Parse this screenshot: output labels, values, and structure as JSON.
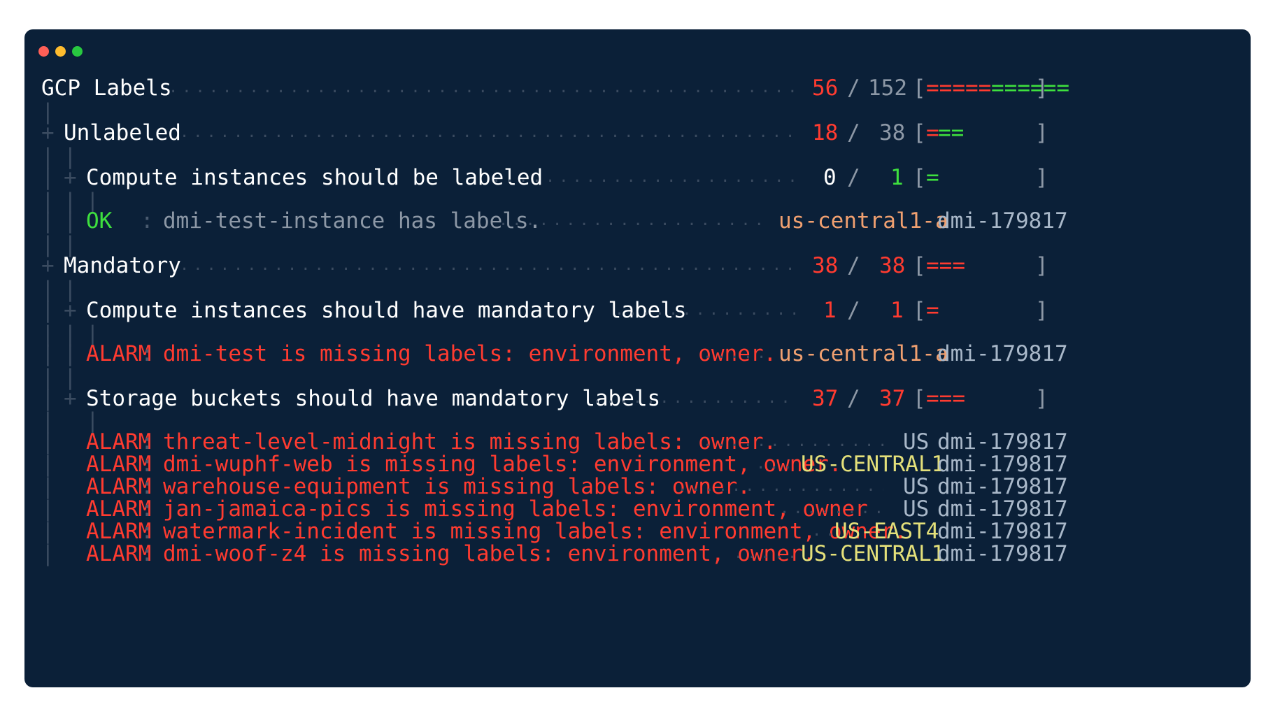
{
  "window": {
    "controls": [
      "close",
      "minimize",
      "maximize"
    ]
  },
  "rows": {
    "root": {
      "title": "GCP Labels",
      "alarm": "56",
      "sep": "/",
      "total": "152",
      "bar_open": "[",
      "bar_red": "=====",
      "bar_green": "======",
      "bar_close": "]"
    },
    "unlabeled": {
      "tree": "+",
      "title": "Unlabeled",
      "alarm": "18",
      "sep": "/",
      "total": "38",
      "bar_open": "[",
      "bar_red": "=",
      "bar_green": "==",
      "bar_close": "]"
    },
    "unlabeled_ctrl": {
      "tree": "+",
      "title": "Compute instances should be labeled",
      "alarm": "0",
      "sep": "/",
      "total": "1",
      "bar_open": "[",
      "bar_green": "=",
      "bar_close": "]"
    },
    "ok_result": {
      "status": "OK",
      "colon": ":",
      "message": "dmi-test-instance has labels.",
      "region": "us-central1-a",
      "project": "dmi-179817"
    },
    "mandatory": {
      "tree": "+",
      "title": "Mandatory",
      "alarm": "38",
      "sep": "/",
      "total": "38",
      "bar_open": "[",
      "bar_red": "===",
      "bar_close": "]"
    },
    "mandatory_compute": {
      "tree": "+",
      "title": "Compute instances should have mandatory labels",
      "alarm": "1",
      "sep": "/",
      "total": "1",
      "bar_open": "[",
      "bar_red": "=",
      "bar_close": "]"
    },
    "compute_alarm": {
      "status": "ALARM",
      "colon": ":",
      "message": "dmi-test is missing labels: environment, owner.",
      "region": "us-central1-a",
      "project": "dmi-179817"
    },
    "mandatory_storage": {
      "tree": "+",
      "title": "Storage buckets should have mandatory labels",
      "alarm": "37",
      "sep": "/",
      "total": "37",
      "bar_open": "[",
      "bar_red": "===",
      "bar_close": "]"
    }
  },
  "storage_alarms": [
    {
      "status": "ALARM",
      "colon": ":",
      "message": "threat-level-midnight is missing labels: owner.",
      "region": "US",
      "project": "dmi-179817"
    },
    {
      "status": "ALARM",
      "colon": ":",
      "message": "dmi-wuphf-web is missing labels: environment, owner.",
      "region": "US-CENTRAL1",
      "project": "dmi-179817"
    },
    {
      "status": "ALARM",
      "colon": ":",
      "message": "warehouse-equipment is missing labels: owner.",
      "region": "US",
      "project": "dmi-179817"
    },
    {
      "status": "ALARM",
      "colon": ":",
      "message": "jan-jamaica-pics is missing labels: environment, owner",
      "region": "US",
      "project": "dmi-179817"
    },
    {
      "status": "ALARM",
      "colon": ":",
      "message": "watermark-incident is missing labels: environment, owner.",
      "region": "US-EAST4",
      "project": "dmi-179817"
    },
    {
      "status": "ALARM",
      "colon": ":",
      "message": "dmi-woof-z4 is missing labels: environment, owner.",
      "region": "US-CENTRAL1",
      "project": "dmi-179817"
    }
  ],
  "tree_glyph": "|",
  "colors": {
    "background": "#0b2038",
    "alarm": "#ff3b30",
    "ok": "#3ee03e",
    "region_lower": "#f0a070",
    "region_upper": "#e4e07a",
    "project": "#a9b8c9"
  }
}
